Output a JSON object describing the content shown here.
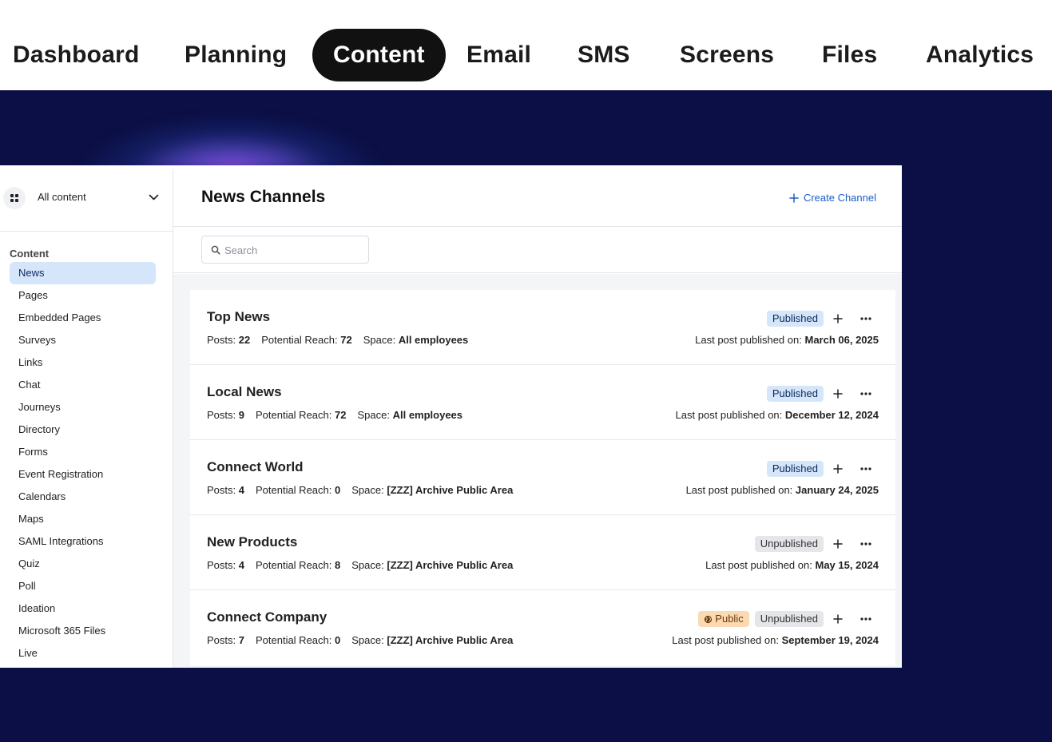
{
  "topnav": {
    "items": [
      {
        "label": "Dashboard",
        "active": false
      },
      {
        "label": "Planning",
        "active": false
      },
      {
        "label": "Content",
        "active": true
      },
      {
        "label": "Email",
        "active": false
      },
      {
        "label": "SMS",
        "active": false
      },
      {
        "label": "Screens",
        "active": false
      },
      {
        "label": "Files",
        "active": false
      },
      {
        "label": "Analytics",
        "active": false
      }
    ]
  },
  "sidebar": {
    "selector_label": "All content",
    "heading": "Content",
    "items": [
      {
        "label": "News",
        "active": true
      },
      {
        "label": "Pages"
      },
      {
        "label": "Embedded Pages"
      },
      {
        "label": "Surveys"
      },
      {
        "label": "Links"
      },
      {
        "label": "Chat"
      },
      {
        "label": "Journeys"
      },
      {
        "label": "Directory"
      },
      {
        "label": "Forms"
      },
      {
        "label": "Event Registration"
      },
      {
        "label": "Calendars"
      },
      {
        "label": "Maps"
      },
      {
        "label": "SAML Integrations"
      },
      {
        "label": "Quiz"
      },
      {
        "label": "Poll"
      },
      {
        "label": "Ideation"
      },
      {
        "label": "Microsoft 365 Files"
      },
      {
        "label": "Live"
      }
    ]
  },
  "main": {
    "title": "News Channels",
    "create_label": "Create Channel",
    "search_placeholder": "Search",
    "meta_labels": {
      "posts": "Posts:",
      "reach": "Potential Reach:",
      "space": "Space:",
      "last_post": "Last post published on:"
    },
    "channels": [
      {
        "name": "Top News",
        "posts": "22",
        "reach": "72",
        "space": "All employees",
        "status": "Published",
        "public": null,
        "last_post": "March 06, 2025"
      },
      {
        "name": "Local News",
        "posts": "9",
        "reach": "72",
        "space": "All employees",
        "status": "Published",
        "public": null,
        "last_post": "December 12, 2024"
      },
      {
        "name": "Connect World",
        "posts": "4",
        "reach": "0",
        "space": "[ZZZ] Archive Public Area",
        "status": "Published",
        "public": null,
        "last_post": "January 24, 2025"
      },
      {
        "name": "New Products",
        "posts": "4",
        "reach": "8",
        "space": "[ZZZ] Archive Public Area",
        "status": "Unpublished",
        "public": null,
        "last_post": "May 15, 2024"
      },
      {
        "name": "Connect Company",
        "posts": "7",
        "reach": "0",
        "space": "[ZZZ] Archive Public Area",
        "status": "Unpublished",
        "public": "Public",
        "last_post": "September 19, 2024"
      }
    ]
  },
  "colors": {
    "background": "#0b0f45",
    "accent": "#1c5fc8",
    "published_badge": "#d5e6fb",
    "unpublished_badge": "#e5e6e9",
    "public_badge": "#fbd9b3",
    "active_nav": "#111111"
  }
}
